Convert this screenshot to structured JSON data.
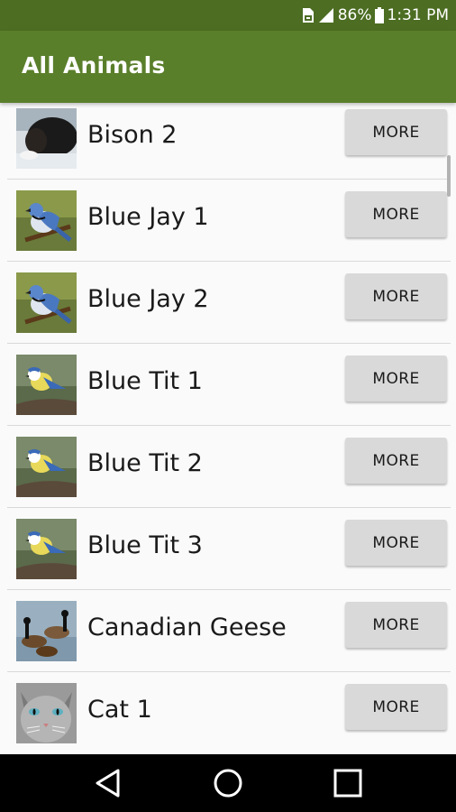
{
  "status_bar": {
    "battery_percent": "86%",
    "time": "1:31 PM",
    "icons": [
      "sim-icon",
      "signal-icon",
      "battery-icon"
    ]
  },
  "app_bar": {
    "title": "All Animals"
  },
  "list": {
    "items": [
      {
        "label": "Bison 2",
        "button": "MORE",
        "thumbnail": "bison"
      },
      {
        "label": "Blue Jay 1",
        "button": "MORE",
        "thumbnail": "blue-jay"
      },
      {
        "label": "Blue Jay 2",
        "button": "MORE",
        "thumbnail": "blue-jay"
      },
      {
        "label": "Blue Tit 1",
        "button": "MORE",
        "thumbnail": "blue-tit"
      },
      {
        "label": "Blue Tit 2",
        "button": "MORE",
        "thumbnail": "blue-tit"
      },
      {
        "label": "Blue Tit 3",
        "button": "MORE",
        "thumbnail": "blue-tit"
      },
      {
        "label": "Canadian Geese",
        "button": "MORE",
        "thumbnail": "geese"
      },
      {
        "label": "Cat 1",
        "button": "MORE",
        "thumbnail": "cat"
      }
    ]
  },
  "nav_bar": {
    "buttons": [
      "back-icon",
      "home-icon",
      "recents-icon"
    ]
  },
  "colors": {
    "status_bar": "#4c6d22",
    "app_bar": "#5a7f2b",
    "button_bg": "#d9d9d9",
    "background": "#fafafa"
  }
}
